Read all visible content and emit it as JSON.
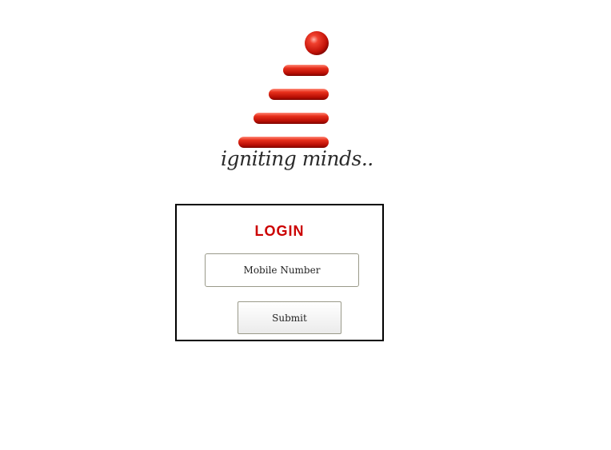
{
  "logo": {
    "tagline": "igniting minds..",
    "accent_color": "#cc1a14"
  },
  "login": {
    "title": "LOGIN",
    "title_color": "#cc0000",
    "mobile_placeholder": "Mobile Number",
    "mobile_value": "",
    "submit_label": "Submit"
  }
}
